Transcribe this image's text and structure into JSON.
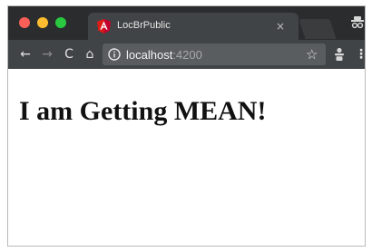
{
  "browser": {
    "tab": {
      "title": "LocBrPublic",
      "favicon": "angular-icon",
      "close_label": "×"
    },
    "toolbar": {
      "back_icon": "←",
      "forward_icon": "→",
      "reload_icon": "C",
      "home_icon": "⌂",
      "url_host": "localhost",
      "url_port": ":4200",
      "star_icon": "☆",
      "menu_icon": "⋮"
    }
  },
  "page": {
    "heading": "I am Getting MEAN!"
  },
  "colors": {
    "tabstrip": "#2a2c2e",
    "tab_active": "#414446",
    "angular_red": "#dd1b16",
    "close_red": "#fc5f57",
    "minimize_yellow": "#fdbc2f",
    "zoom_green": "#29c840"
  }
}
